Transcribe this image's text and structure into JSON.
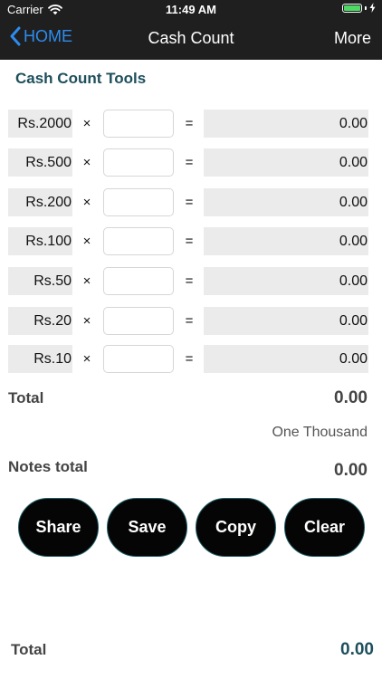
{
  "status_bar": {
    "carrier": "Carrier",
    "time": "11:49 AM",
    "battery_color": "#4cd964"
  },
  "nav": {
    "back_label": "HOME",
    "title": "Cash Count",
    "more_label": "More",
    "back_color": "#2d8cf0"
  },
  "section_title": "Cash Count Tools",
  "operators": {
    "times": "×",
    "equals": "="
  },
  "denominations": [
    {
      "label": "Rs.2000",
      "quantity": "",
      "amount": "0.00"
    },
    {
      "label": "Rs.500",
      "quantity": "",
      "amount": "0.00"
    },
    {
      "label": "Rs.200",
      "quantity": "",
      "amount": "0.00"
    },
    {
      "label": "Rs.100",
      "quantity": "",
      "amount": "0.00"
    },
    {
      "label": "Rs.50",
      "quantity": "",
      "amount": "0.00"
    },
    {
      "label": "Rs.20",
      "quantity": "",
      "amount": "0.00"
    },
    {
      "label": "Rs.10",
      "quantity": "",
      "amount": "0.00"
    }
  ],
  "summary": {
    "total_label": "Total",
    "total_value": "0.00",
    "amount_in_words": "One Thousand",
    "notes_total_label": "Notes total",
    "notes_total_value": "0.00"
  },
  "actions": {
    "share": "Share",
    "save": "Save",
    "copy": "Copy",
    "clear": "Clear"
  },
  "footer": {
    "total_label": "Total",
    "total_value": "0.00"
  },
  "icons": {
    "wifi": "wifi-icon",
    "battery": "battery-icon",
    "charging": "charging-bolt-icon",
    "back": "chevron-left-icon"
  }
}
